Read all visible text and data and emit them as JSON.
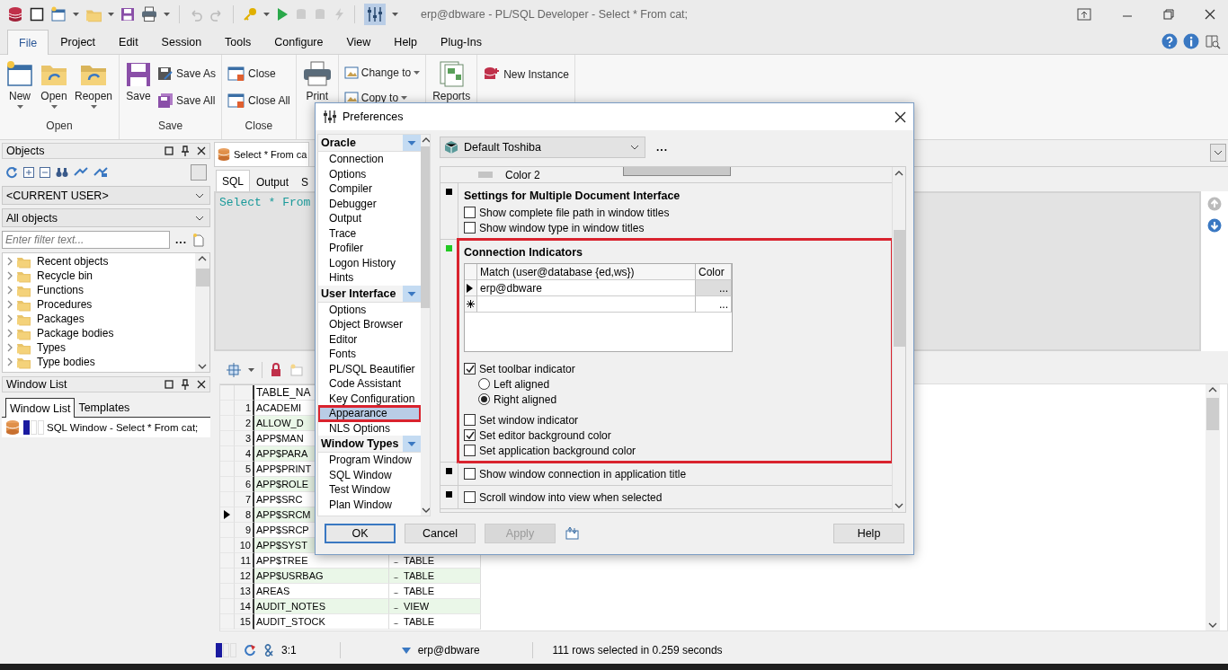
{
  "window": {
    "title": "erp@dbware - PL/SQL Developer - Select * From cat;"
  },
  "menu_tabs": [
    {
      "label": "File",
      "selected": true
    },
    {
      "label": "Project",
      "selected": false
    },
    {
      "label": "Edit",
      "selected": false
    },
    {
      "label": "Session",
      "selected": false
    },
    {
      "label": "Tools",
      "selected": false
    },
    {
      "label": "Configure",
      "selected": false
    },
    {
      "label": "View",
      "selected": false
    },
    {
      "label": "Help",
      "selected": false
    },
    {
      "label": "Plug-Ins",
      "selected": false
    }
  ],
  "ribbon": [
    {
      "label": "Open",
      "items": [
        {
          "kind": "large",
          "label": "New",
          "dropdown": true
        },
        {
          "kind": "large",
          "label": "Open",
          "dropdown": true
        },
        {
          "kind": "large",
          "label": "Reopen",
          "dropdown": true
        }
      ]
    },
    {
      "label": "Save",
      "items": [
        {
          "kind": "large",
          "label": "Save",
          "dropdown": false
        },
        {
          "kind": "small",
          "label": "Save As",
          "dropdown": false
        },
        {
          "kind": "small",
          "label": "Save All",
          "dropdown": false
        }
      ]
    },
    {
      "label": "Close",
      "items": [
        {
          "kind": "small",
          "label": "Close",
          "dropdown": false
        },
        {
          "kind": "small",
          "label": "Close All",
          "dropdown": false
        }
      ]
    },
    {
      "items": [
        {
          "kind": "large",
          "label": "Print",
          "dropdown": false
        }
      ]
    },
    {
      "items": [
        {
          "kind": "small",
          "label": "Change to",
          "dropdown": true
        },
        {
          "kind": "small",
          "label": "Copy to",
          "dropdown": true
        }
      ]
    },
    {
      "items": [
        {
          "kind": "large",
          "label": "Reports",
          "dropdown": false
        }
      ]
    },
    {
      "items": [
        {
          "kind": "small",
          "label": "New Instance",
          "dropdown": false
        }
      ]
    }
  ],
  "objects_panel": {
    "title": "Objects",
    "owner": "<CURRENT USER>",
    "filter": "All objects",
    "search": {
      "placeholder": "Enter filter text..."
    },
    "more": "...",
    "tree": [
      {
        "label": "Recent objects",
        "expanded": false
      },
      {
        "label": "Recycle bin",
        "expanded": false
      },
      {
        "label": "Functions",
        "expanded": false
      },
      {
        "label": "Procedures",
        "expanded": false
      },
      {
        "label": "Packages",
        "expanded": false
      },
      {
        "label": "Package bodies",
        "expanded": false
      },
      {
        "label": "Types",
        "expanded": false
      },
      {
        "label": "Type bodies",
        "expanded": false
      }
    ]
  },
  "window_list": {
    "title": "Window List",
    "tabs": [
      {
        "label": "Window List",
        "selected": true
      },
      {
        "label": "Templates",
        "selected": false
      }
    ],
    "items": [
      {
        "label": "SQL Window - Select * From cat;"
      }
    ]
  },
  "document_tab": {
    "label": "Select * From ca"
  },
  "sql_tabs": [
    {
      "label": "SQL",
      "selected": true
    },
    {
      "label": "Output",
      "selected": false
    },
    {
      "label": "S",
      "selected": false
    }
  ],
  "editor": {
    "text": "Select * From"
  },
  "results": {
    "columns": [
      "TABLE_NA"
    ],
    "rows": [
      {
        "number": "1",
        "column_1": "ACADEMI",
        "current": false
      },
      {
        "number": "2",
        "column_1": "ALLOW_D",
        "current": false
      },
      {
        "number": "3",
        "column_1": "APP$MAN",
        "current": false
      },
      {
        "number": "4",
        "column_1": "APP$PARA",
        "current": false
      },
      {
        "number": "5",
        "column_1": "APP$PRINT",
        "current": false
      },
      {
        "number": "6",
        "column_1": "APP$ROLE",
        "current": false
      },
      {
        "number": "7",
        "column_1": "APP$SRC",
        "current": false
      },
      {
        "number": "8",
        "column_1": "APP$SRCM",
        "current": true
      },
      {
        "number": "9",
        "column_1": "APP$SRCP",
        "current": false
      },
      {
        "number": "10",
        "column_1": "APP$SYST",
        "current": false
      },
      {
        "number": "11",
        "column_1": "APP$TREE",
        "button": "...",
        "column_2": "TABLE",
        "current": false
      },
      {
        "number": "12",
        "column_1": "APP$USRBAG",
        "button": "...",
        "column_2": "TABLE",
        "current": false
      },
      {
        "number": "13",
        "column_1": "AREAS",
        "button": "...",
        "column_2": "TABLE",
        "current": false
      },
      {
        "number": "14",
        "column_1": "AUDIT_NOTES",
        "button": "...",
        "column_2": "VIEW",
        "current": false
      },
      {
        "number": "15",
        "column_1": "AUDIT_STOCK",
        "button": "...",
        "column_2": "TABLE",
        "current": false
      }
    ]
  },
  "status_bar": {
    "position": "3:1",
    "connection": "erp@dbware",
    "message": "111 rows selected in 0.259 seconds"
  },
  "preferences": {
    "title": "Preferences",
    "nav": [
      {
        "title": "Oracle",
        "items": [
          {
            "label": "Connection",
            "selected": false,
            "highlighted": false
          },
          {
            "label": "Options",
            "selected": false,
            "highlighted": false
          },
          {
            "label": "Compiler",
            "selected": false,
            "highlighted": false
          },
          {
            "label": "Debugger",
            "selected": false,
            "highlighted": false
          },
          {
            "label": "Output",
            "selected": false,
            "highlighted": false
          },
          {
            "label": "Trace",
            "selected": false,
            "highlighted": false
          },
          {
            "label": "Profiler",
            "selected": false,
            "highlighted": false
          },
          {
            "label": "Logon History",
            "selected": false,
            "highlighted": false
          },
          {
            "label": "Hints",
            "selected": false,
            "highlighted": false
          }
        ]
      },
      {
        "title": "User Interface",
        "items": [
          {
            "label": "Options",
            "selected": false,
            "highlighted": false
          },
          {
            "label": "Object Browser",
            "selected": false,
            "highlighted": false
          },
          {
            "label": "Editor",
            "selected": false,
            "highlighted": false
          },
          {
            "label": "Fonts",
            "selected": false,
            "highlighted": false
          },
          {
            "label": "PL/SQL Beautifier",
            "selected": false,
            "highlighted": false
          },
          {
            "label": "Code Assistant",
            "selected": false,
            "highlighted": false
          },
          {
            "label": "Key Configuration",
            "selected": false,
            "highlighted": false
          },
          {
            "label": "Appearance",
            "selected": true,
            "highlighted": true
          },
          {
            "label": "NLS Options",
            "selected": false,
            "highlighted": false
          }
        ]
      },
      {
        "title": "Window Types",
        "items": [
          {
            "label": "Program Window",
            "selected": false,
            "highlighted": false
          },
          {
            "label": "SQL Window",
            "selected": false,
            "highlighted": false
          },
          {
            "label": "Test Window",
            "selected": false,
            "highlighted": false
          },
          {
            "label": "Plan Window",
            "selected": false,
            "highlighted": false
          }
        ]
      }
    ],
    "profile": "Default Toshiba",
    "more": "...",
    "settings": [
      {
        "kind": "color",
        "label": "Color 2"
      },
      {
        "kind": "group",
        "color": "#000000",
        "title": "Settings for Multiple Document Interface",
        "highlighted": false,
        "options": [
          {
            "kind": "checkbox",
            "label": "Show complete file path in window titles",
            "checked": false
          },
          {
            "kind": "checkbox",
            "label": "Show window type in window titles",
            "checked": false
          }
        ]
      },
      {
        "kind": "group",
        "color": "#22c922",
        "title": "Connection Indicators",
        "highlighted": true,
        "grid": {
          "columns": [
            "Match (user@database {ed,ws})",
            "Color"
          ],
          "rows": [
            {
              "kind": "data",
              "match": "erp@dbware",
              "button": "..."
            },
            {
              "kind": "new",
              "button": "..."
            }
          ]
        },
        "options": [
          {
            "kind": "checkbox",
            "label": "Set toolbar indicator",
            "checked": true,
            "children": [
              {
                "kind": "radio",
                "label": "Left aligned",
                "selected": false
              },
              {
                "kind": "radio",
                "label": "Right aligned",
                "selected": true
              }
            ]
          },
          {
            "kind": "checkbox",
            "label": "Set window indicator",
            "checked": false
          },
          {
            "kind": "checkbox",
            "label": "Set editor background color",
            "checked": true
          },
          {
            "kind": "checkbox",
            "label": "Set application background color",
            "checked": false
          }
        ]
      },
      {
        "kind": "group",
        "color": "#000000",
        "highlighted": false,
        "options": [
          {
            "kind": "checkbox",
            "label": "Show window connection in application title",
            "checked": false
          }
        ]
      },
      {
        "kind": "group",
        "color": "#000000",
        "highlighted": false,
        "options": [
          {
            "kind": "checkbox",
            "label": "Scroll window into view when selected",
            "checked": false
          }
        ]
      }
    ],
    "buttons": [
      {
        "label": "OK",
        "default": true,
        "disabled": false
      },
      {
        "label": "Cancel",
        "default": false,
        "disabled": false
      },
      {
        "label": "Apply",
        "default": false,
        "disabled": true
      },
      {
        "label": "Help",
        "default": false,
        "disabled": false
      }
    ]
  }
}
